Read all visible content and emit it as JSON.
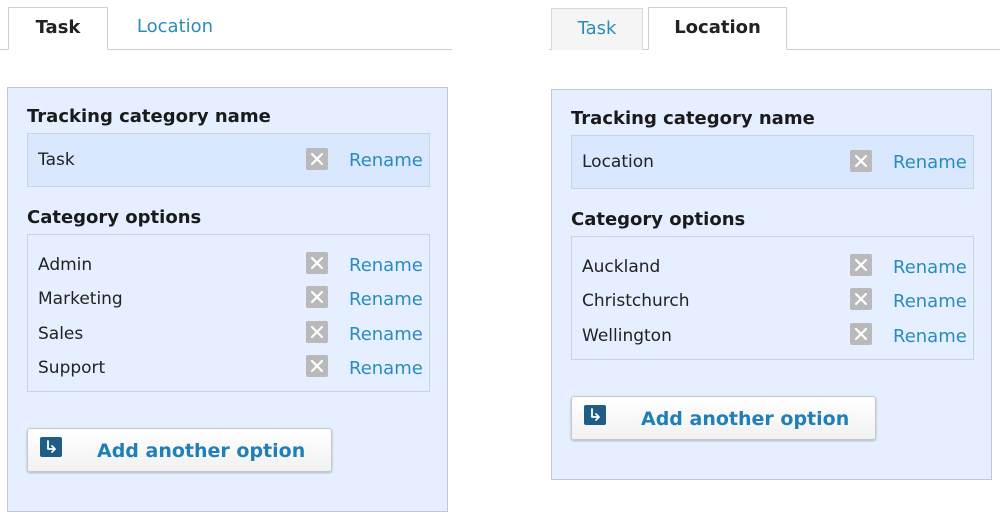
{
  "colors": {
    "accent_link": "#2a8bbf",
    "panel_background": "#e6efff",
    "name_row_background": "#d9e7ff",
    "add_icon_background": "#1f5d86",
    "remove_icon_background": "#b9b9b9"
  },
  "left_panel": {
    "tabs": [
      {
        "label": "Task",
        "active": true
      },
      {
        "label": "Location",
        "active": false
      }
    ],
    "tracking_category_title": "Tracking category name",
    "category_name": {
      "label": "Task",
      "rename_label": "Rename",
      "remove_icon": "close-icon"
    },
    "category_options_title": "Category options",
    "options": [
      {
        "label": "Admin",
        "rename_label": "Rename"
      },
      {
        "label": "Marketing",
        "rename_label": "Rename"
      },
      {
        "label": "Sales",
        "rename_label": "Rename"
      },
      {
        "label": "Support",
        "rename_label": "Rename"
      }
    ],
    "add_option_label": "Add another option",
    "add_option_icon": "arrow-down-right-icon"
  },
  "right_panel": {
    "tabs": [
      {
        "label": "Task",
        "active": false
      },
      {
        "label": "Location",
        "active": true
      }
    ],
    "tracking_category_title": "Tracking category name",
    "category_name": {
      "label": "Location",
      "rename_label": "Rename",
      "remove_icon": "close-icon"
    },
    "category_options_title": "Category options",
    "options": [
      {
        "label": "Auckland",
        "rename_label": "Rename"
      },
      {
        "label": "Christchurch",
        "rename_label": "Rename"
      },
      {
        "label": "Wellington",
        "rename_label": "Rename"
      }
    ],
    "add_option_label": "Add another option",
    "add_option_icon": "arrow-down-right-icon"
  }
}
